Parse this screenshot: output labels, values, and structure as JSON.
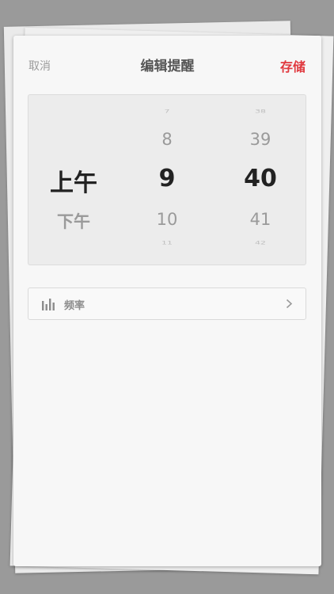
{
  "header": {
    "cancel_label": "取消",
    "title": "编辑提醒",
    "save_label": "存储"
  },
  "picker": {
    "ampm": {
      "selected": "上午",
      "after": "下午"
    },
    "hour": {
      "before2": "7",
      "before1": "8",
      "selected": "9",
      "after1": "10",
      "after2": "11"
    },
    "minute": {
      "before2": "38",
      "before1": "39",
      "selected": "40",
      "after1": "41",
      "after2": "42"
    }
  },
  "frequency": {
    "label": "频率",
    "icon": "bar-chart-icon",
    "arrow_icon": "chevron-right-icon"
  },
  "colors": {
    "accent": "#e0383e",
    "background": "#9a9a9a",
    "card": "#f7f7f7"
  }
}
